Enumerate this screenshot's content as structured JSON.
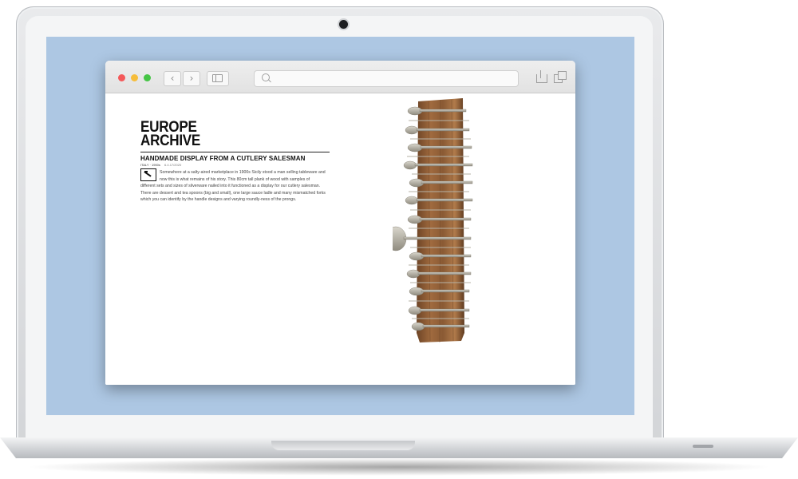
{
  "browser": {
    "back_glyph": "‹",
    "forward_glyph": "›",
    "search_icon": "search-icon",
    "share_icon": "share-icon",
    "tabs_icon": "tabs-icon"
  },
  "page": {
    "title_line1": "EUROPE",
    "title_line2": "ARCHIVE",
    "subtitle": "HANDMADE DISPLAY FROM A CUTLERY SALESMAN",
    "meta_origin": "ITALY · 1900s",
    "meta_date": "6.4.17/2020",
    "body": "Somewhere at a salty-aired marketplace in 1900s Sicily stood a man selling tableware and now this is what remains of his story. This 80cm tall plank of wood with samples of different sets and sizes of silverware nailed into it functioned as a display for our cutlery salesman. There are dessert and tea spoons (big and small), one large sauce ladle and many mismatched forks which you can identify by the handle designs and varying roundly-ness of the prongs."
  },
  "colors": {
    "screen_bg": "#adc7e3",
    "traffic_red": "#f4595a",
    "traffic_yellow": "#f6bd3b",
    "traffic_green": "#45c545"
  }
}
